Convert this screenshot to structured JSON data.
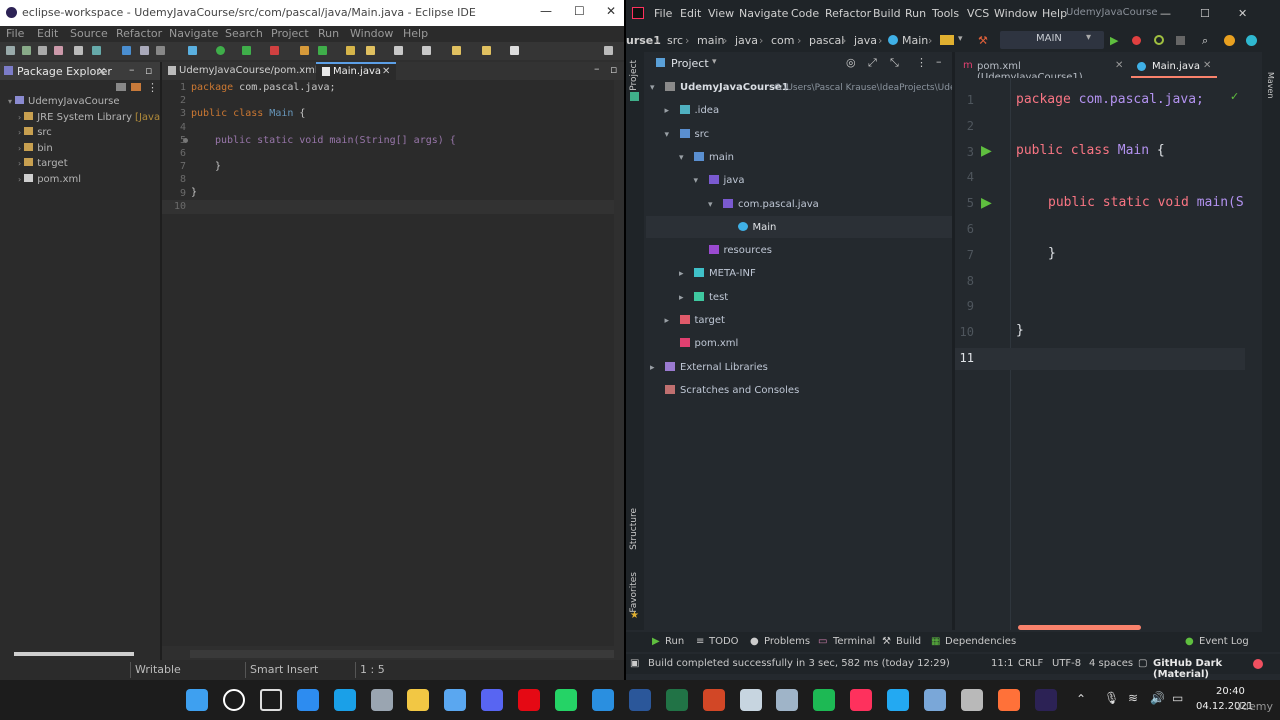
{
  "eclipse": {
    "window_title": "eclipse-workspace - UdemyJavaCourse/src/com/pascal/java/Main.java - Eclipse IDE",
    "menu": [
      "File",
      "Edit",
      "Source",
      "Refactor",
      "Navigate",
      "Search",
      "Project",
      "Run",
      "Window",
      "Help"
    ],
    "package_explorer": {
      "tab_label": "Package Explorer",
      "tree": [
        {
          "label": "UdemyJavaCourse",
          "indent": 0
        },
        {
          "label": "JRE System Library",
          "suffix": "[JavaSE",
          "indent": 1
        },
        {
          "label": "src",
          "indent": 1
        },
        {
          "label": "bin",
          "indent": 1
        },
        {
          "label": "target",
          "indent": 1
        },
        {
          "label": "pom.xml",
          "indent": 1
        }
      ]
    },
    "editor_tabs": [
      {
        "label": "UdemyJavaCourse/pom.xml",
        "active": false
      },
      {
        "label": "Main.java",
        "active": true
      }
    ],
    "line_numbers": [
      "1",
      "2",
      "3",
      "4",
      "5",
      "6",
      "7",
      "8",
      "9",
      "10"
    ],
    "code": {
      "l1_kw": "package",
      "l1_rest": " com.pascal.java;",
      "l3_kw1": "public",
      "l3_kw2": "class",
      "l3_name": "Main",
      "l3_rest": " {",
      "l5": "public static void main(String[] args) {",
      "l7": "}",
      "l9": "}"
    },
    "status": {
      "writable": "Writable",
      "insert": "Smart Insert",
      "position": "1 : 5"
    }
  },
  "idea": {
    "menu": [
      "File",
      "Edit",
      "View",
      "Navigate",
      "Code",
      "Refactor",
      "Build",
      "Run",
      "Tools",
      "VCS",
      "Window",
      "Help"
    ],
    "project_name": "UdemyJavaCourse",
    "breadcrumb": [
      "urse1",
      "src",
      "main",
      "java",
      "com",
      "pascal",
      "java",
      "Main"
    ],
    "run_config": "MAIN",
    "project_panel_title": "Project",
    "project_path": "C:\\Users\\Pascal Krause\\IdeaProjects\\Ude",
    "tree": [
      {
        "label": "UdemyJavaCourse1",
        "indent": 0,
        "arrow": "▾",
        "color": "#d9dde3"
      },
      {
        "label": ".idea",
        "indent": 1,
        "arrow": "▸",
        "color": "#bfc7d5"
      },
      {
        "label": "src",
        "indent": 1,
        "arrow": "▾",
        "color": "#bfc7d5"
      },
      {
        "label": "main",
        "indent": 2,
        "arrow": "▾",
        "color": "#bfc7d5"
      },
      {
        "label": "java",
        "indent": 3,
        "arrow": "▾",
        "color": "#bfc7d5"
      },
      {
        "label": "com.pascal.java",
        "indent": 4,
        "arrow": "▾",
        "color": "#bfc7d5"
      },
      {
        "label": "Main",
        "indent": 5,
        "arrow": "",
        "color": "#e1e4e8"
      },
      {
        "label": "resources",
        "indent": 3,
        "arrow": "",
        "color": "#bfc7d5"
      },
      {
        "label": "META-INF",
        "indent": 2,
        "arrow": "▸",
        "color": "#bfc7d5"
      },
      {
        "label": "test",
        "indent": 2,
        "arrow": "▸",
        "color": "#bfc7d5"
      },
      {
        "label": "target",
        "indent": 1,
        "arrow": "▸",
        "color": "#bfc7d5"
      },
      {
        "label": "pom.xml",
        "indent": 1,
        "arrow": "",
        "color": "#bfc7d5"
      },
      {
        "label": "External Libraries",
        "indent": 0,
        "arrow": "▸",
        "color": "#bfc7d5"
      },
      {
        "label": "Scratches and Consoles",
        "indent": 0,
        "arrow": "",
        "color": "#bfc7d5"
      }
    ],
    "editor_tabs": [
      {
        "label": "pom.xml (UdemyJavaCourse1)",
        "active": false
      },
      {
        "label": "Main.java",
        "active": true
      }
    ],
    "line_numbers": [
      "1",
      "2",
      "3",
      "4",
      "5",
      "6",
      "7",
      "8",
      "9",
      "10",
      "11"
    ],
    "code": {
      "l1_kw": "package",
      "l1_rest": " com.pascal.java;",
      "l3_kw": "public class",
      "l3_name": " Main",
      "l3_rest": " {",
      "l5_kw": "public static void",
      "l5_name": " main(S",
      "l7": "}",
      "l10": "}"
    },
    "left_tools": [
      "Project",
      "Structure",
      "Favorites"
    ],
    "right_tools": [
      "Maven"
    ],
    "bottom_tools": [
      "Run",
      "TODO",
      "Problems",
      "Terminal",
      "Build",
      "Dependencies",
      "Event Log"
    ],
    "status": {
      "message": "Build completed successfully in 3 sec, 582 ms (today 12:29)",
      "position": "11:1",
      "line_sep": "CRLF",
      "encoding": "UTF-8",
      "indent": "4 spaces",
      "theme": "GitHub Dark (Material)"
    }
  },
  "taskbar": {
    "time": "20:40",
    "date": "04.12.2021",
    "watermark": "Udemy",
    "apps": [
      {
        "name": "windows-start-icon",
        "color": "#3ea0f0"
      },
      {
        "name": "search-icon",
        "color": "#ffffff"
      },
      {
        "name": "task-view-icon",
        "color": "#dddddd"
      },
      {
        "name": "file-explorer-docs-icon",
        "color": "#2d8cf0"
      },
      {
        "name": "edge-icon",
        "color": "#1aa0e8"
      },
      {
        "name": "settings-icon",
        "color": "#9aa5b1"
      },
      {
        "name": "file-explorer-icon",
        "color": "#f2c744"
      },
      {
        "name": "store-icon",
        "color": "#5aa7f0"
      },
      {
        "name": "discord-icon",
        "color": "#5865f2"
      },
      {
        "name": "netflix-icon",
        "color": "#e50914"
      },
      {
        "name": "whatsapp-icon",
        "color": "#25d366"
      },
      {
        "name": "mail-icon",
        "color": "#2a8fe0"
      },
      {
        "name": "word-icon",
        "color": "#2b579a"
      },
      {
        "name": "excel-icon",
        "color": "#217346"
      },
      {
        "name": "powerpoint-icon",
        "color": "#d24726"
      },
      {
        "name": "steam-icon",
        "color": "#c7d5e0"
      },
      {
        "name": "chrome-like-icon",
        "color": "#9fb4c8"
      },
      {
        "name": "spotify-icon",
        "color": "#1db954"
      },
      {
        "name": "intellij-icon",
        "color": "#fe315d"
      },
      {
        "name": "vscode-icon",
        "color": "#23a9f2"
      },
      {
        "name": "photo-icon",
        "color": "#7aa7d8"
      },
      {
        "name": "database-icon",
        "color": "#b9b9b9"
      },
      {
        "name": "firefox-icon",
        "color": "#ff7139"
      },
      {
        "name": "eclipse-icon",
        "color": "#2c2255"
      }
    ]
  }
}
